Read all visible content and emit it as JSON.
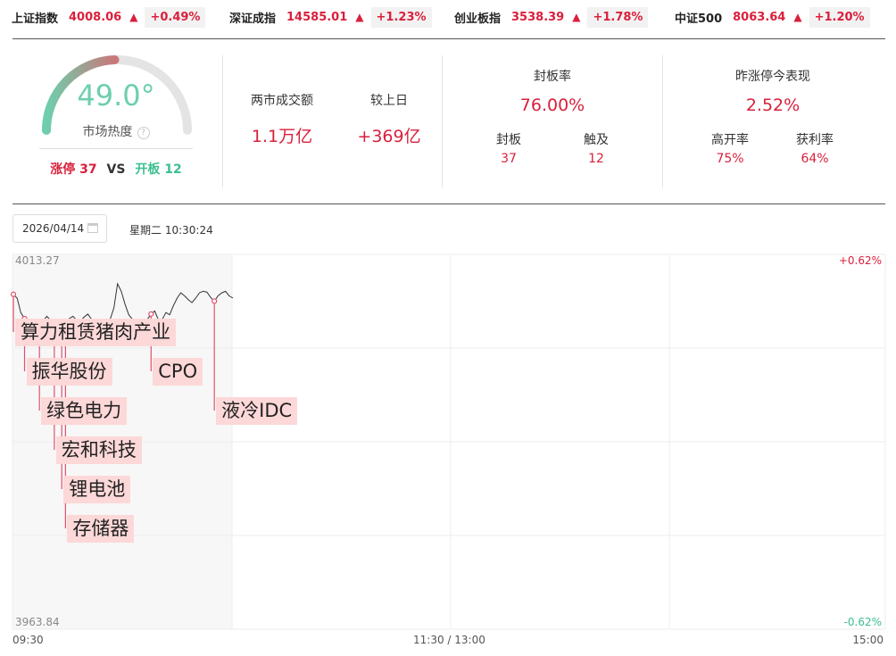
{
  "indices": [
    {
      "name": "上证指数",
      "points": "4008.06",
      "arrow": "▲",
      "change": "+0.49%"
    },
    {
      "name": "深证成指",
      "points": "14585.01",
      "arrow": "▲",
      "change": "+1.23%"
    },
    {
      "name": "创业板指",
      "points": "3538.39",
      "arrow": "▲",
      "change": "+1.78%"
    },
    {
      "name": "中证500",
      "points": "8063.64",
      "arrow": "▲",
      "change": "+1.20%"
    }
  ],
  "heat": {
    "value": "49.0°",
    "level": 0.49,
    "label": "市场热度",
    "help_icon": "?",
    "limit_up_label": "涨停",
    "limit_up": "37",
    "vs": "VS",
    "opened_label": "开板",
    "opened": "12",
    "colors": {
      "cool": "#6dcfad",
      "hot": "#c9787a",
      "track": "#e4e4e4"
    }
  },
  "turnover": {
    "label1": "两市成交额",
    "value1": "1.1万亿",
    "label2": "较上日",
    "value2": "+369亿"
  },
  "seal": {
    "title": "封板率",
    "rate": "76.00%",
    "sub1_label": "封板",
    "sub1_value": "37",
    "sub2_label": "触及",
    "sub2_value": "12"
  },
  "yesterday": {
    "title": "昨涨停今表现",
    "rate": "2.52%",
    "sub1_label": "高开率",
    "sub1_value": "75%",
    "sub2_label": "获利率",
    "sub2_value": "64%"
  },
  "date": {
    "value": "2026/04/14",
    "weekday_time": "星期二 10:30:24",
    "calendar_icon": "calendar-icon"
  },
  "chart_data": {
    "type": "line",
    "y_top": "4013.27",
    "y_bottom": "3963.84",
    "pct_top": "+0.62%",
    "pct_bottom": "-0.62%",
    "x_start": "09:30",
    "x_mid": "11:30 / 13:00",
    "x_end": "15:00",
    "ylim": [
      3963.84,
      4013.27
    ],
    "base": 3988.55,
    "series": [
      {
        "values": [
          4008.0,
          4007.5,
          4005.6,
          4004.8,
          4004.0,
          4004.3,
          4003.5,
          4003.9,
          4004.5,
          4005.1,
          4004.6,
          4004.2,
          4003.8,
          4003.6,
          4004.2,
          4004.8,
          4005.1,
          4004.6,
          4004.5,
          4005.0,
          4005.4,
          4004.7,
          4004.2,
          4004.6,
          4004.4,
          4003.9,
          4004.7,
          4006.2,
          4009.4,
          4008.4,
          4006.7,
          4005.3,
          4004.7,
          4003.7,
          4003.8,
          4003.9,
          4004.7,
          4005.4,
          4005.8,
          4004.6,
          4004.7,
          4005.6,
          4005.3,
          4006.5,
          4007.5,
          4008.2,
          4007.8,
          4007.3,
          4006.9,
          4007.5,
          4008.2,
          4008.4,
          4008.3,
          4007.6,
          4007.1,
          4007.8,
          4008.2,
          4008.4,
          4007.8,
          4007.5
        ]
      }
    ],
    "events": [
      {
        "name": "算力租赁猪肉产业",
        "time_index": 0
      },
      {
        "name": "振华股份",
        "time_index": 3
      },
      {
        "name": "绿色电力",
        "time_index": 7
      },
      {
        "name": "宏和科技",
        "time_index": 11
      },
      {
        "name": "锂电池",
        "time_index": 13
      },
      {
        "name": "存储器",
        "time_index": 14
      },
      {
        "name": "CPO",
        "time_index": 37
      },
      {
        "name": "液冷IDC",
        "time_index": 54
      }
    ]
  }
}
